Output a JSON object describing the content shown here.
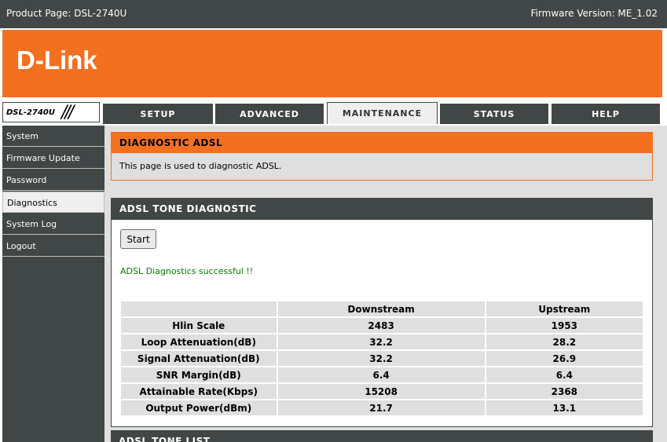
{
  "topbar": {
    "product": "Product Page: DSL-2740U",
    "firmware": "Firmware Version: ME_1.02"
  },
  "brand": {
    "logo": "D-Link",
    "model": "DSL-2740U",
    "accent": "#f37021",
    "dark": "#414646"
  },
  "tabs": [
    {
      "label": "SETUP"
    },
    {
      "label": "ADVANCED"
    },
    {
      "label": "MAINTENANCE"
    },
    {
      "label": "STATUS"
    },
    {
      "label": "HELP"
    }
  ],
  "sidebar": {
    "items": [
      {
        "label": "System"
      },
      {
        "label": "Firmware Update"
      },
      {
        "label": "Password"
      },
      {
        "label": "Diagnostics"
      },
      {
        "label": "System Log"
      },
      {
        "label": "Logout"
      }
    ]
  },
  "diagnostic": {
    "title": "DIAGNOSTIC ADSL",
    "description": "This page is used to diagnostic ADSL."
  },
  "tone": {
    "title": "ADSL TONE DIAGNOSTIC",
    "start_label": "Start",
    "status": "ADSL Diagnostics successful !!",
    "columns": [
      "",
      "Downstream",
      "Upstream"
    ],
    "rows": [
      [
        "Hlin Scale",
        "2483",
        "1953"
      ],
      [
        "Loop Attenuation(dB)",
        "32.2",
        "28.2"
      ],
      [
        "Signal Attenuation(dB)",
        "32.2",
        "26.9"
      ],
      [
        "SNR Margin(dB)",
        "6.4",
        "6.4"
      ],
      [
        "Attainable Rate(Kbps)",
        "15208",
        "2368"
      ],
      [
        "Output Power(dBm)",
        "21.7",
        "13.1"
      ]
    ]
  },
  "tone_list": {
    "title": "ADSL TONE LIST"
  }
}
